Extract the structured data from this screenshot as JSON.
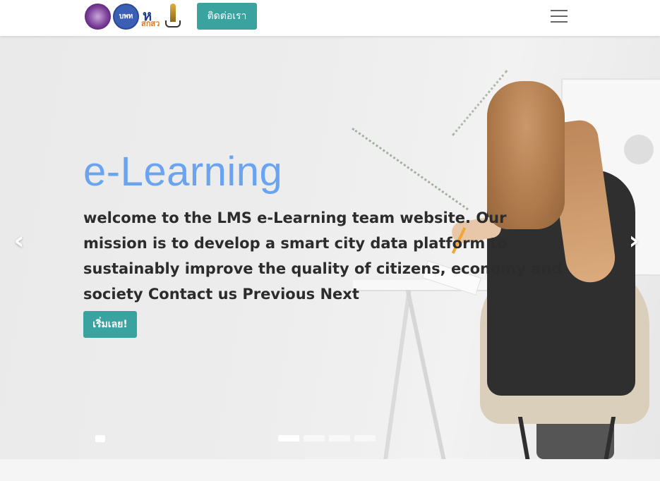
{
  "navbar": {
    "logos": [
      {
        "name": "university-seal-logo",
        "text": ""
      },
      {
        "name": "bpk-logo",
        "text": "บพท"
      },
      {
        "name": "sksw-logo",
        "text": "สกสว"
      },
      {
        "name": "institution-emblem-logo",
        "text": ""
      }
    ],
    "contact_label": "ติดต่อเรา",
    "menu_icon": "hamburger-icon"
  },
  "hero": {
    "title": "e-Learning",
    "text": "welcome to the LMS  e-Learning team website. Our mission is to develop a smart city data platform to sustainably improve the quality of citizens, economy and society Contact us Previous Next",
    "button_label": "เริ่มเลย!",
    "prev_icon": "chevron-left-icon",
    "next_icon": "chevron-right-icon",
    "indicator_count": 4,
    "active_indicator": 0
  },
  "colors": {
    "accent": "#3aa3a0",
    "title": "#6aa3f0",
    "text": "#2c2c2c"
  }
}
